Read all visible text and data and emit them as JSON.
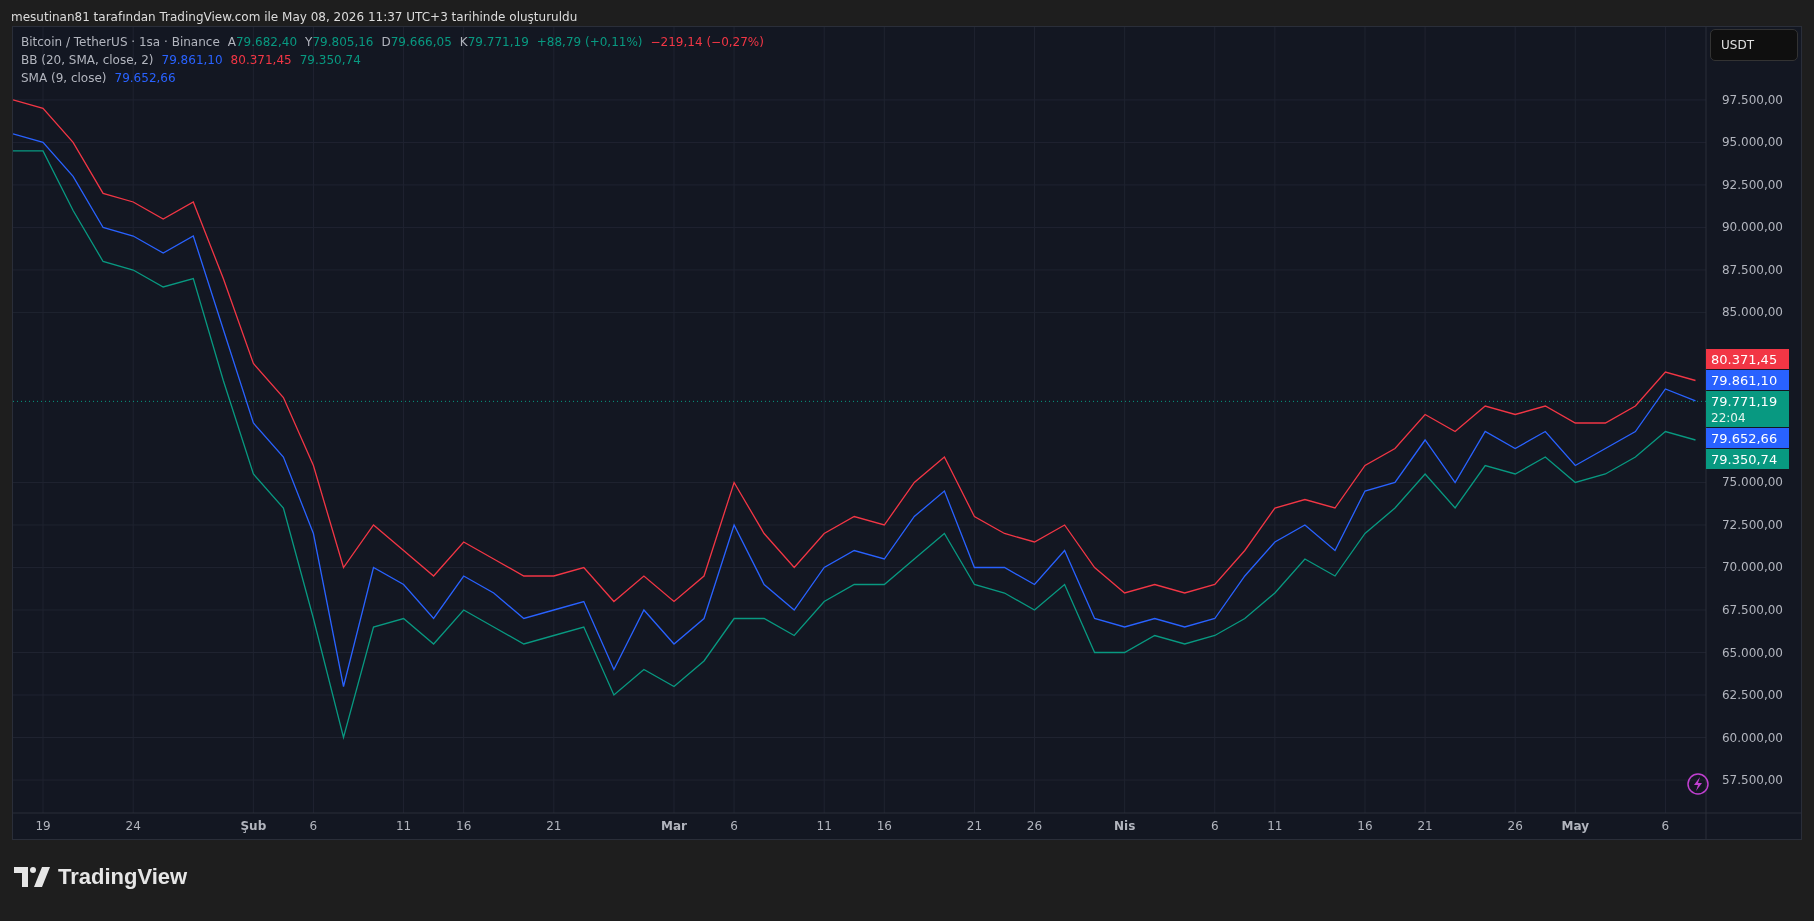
{
  "caption": "mesutinan81 tarafından TradingView.com ile May 08, 2026 11:37 UTC+3 tarihinde oluşturuldu",
  "legend": {
    "symbol": "Bitcoin / TetherUS · 1sa · Binance",
    "ohlc": [
      {
        "label": "A",
        "value": "79.682,40",
        "color": "#089981"
      },
      {
        "label": "Y",
        "value": "79.805,16",
        "color": "#089981"
      },
      {
        "label": "D",
        "value": "79.666,05",
        "color": "#089981"
      },
      {
        "label": "K",
        "value": "79.771,19",
        "color": "#089981"
      }
    ],
    "changes": [
      {
        "text": "+88,79 (+0,11%)",
        "color": "#089981"
      },
      {
        "text": "−219,14 (−0,27%)",
        "color": "#f23645"
      }
    ],
    "indicators": [
      {
        "name": "BB (20, SMA, close, 2)",
        "values": [
          {
            "text": "79.861,10",
            "color": "#2962ff"
          },
          {
            "text": "80.371,45",
            "color": "#f23645"
          },
          {
            "text": "79.350,74",
            "color": "#089981"
          }
        ]
      },
      {
        "name": "SMA (9, close)",
        "values": [
          {
            "text": "79.652,66",
            "color": "#2962ff"
          }
        ]
      }
    ]
  },
  "currency_button": "USDT",
  "price_tags": [
    {
      "value": "80.371,45",
      "color": "#f23645"
    },
    {
      "value": "79.861,10",
      "color": "#2962ff"
    },
    {
      "value": "79.771,19",
      "countdown": "22:04",
      "color": "#089981"
    },
    {
      "value": "79.652,66",
      "color": "#2962ff"
    },
    {
      "value": "79.350,74",
      "color": "#089981"
    }
  ],
  "chart_data": {
    "type": "line",
    "categories": [
      null,
      "19",
      null,
      null,
      "24",
      null,
      null,
      null,
      "Şub",
      null,
      "6",
      null,
      null,
      "11",
      null,
      "16",
      null,
      null,
      "21",
      null,
      null,
      null,
      "Mar",
      null,
      "6",
      null,
      null,
      "11",
      null,
      "16",
      null,
      null,
      "21",
      null,
      "26",
      null,
      null,
      "Nis",
      null,
      null,
      "6",
      null,
      "11",
      null,
      null,
      "16",
      null,
      "21",
      null,
      null,
      "26",
      null,
      "May",
      null,
      null,
      "6",
      null
    ],
    "series": [
      {
        "color": "#f23645",
        "values": [
          97500,
          97000,
          95000,
          92000,
          91500,
          90500,
          91500,
          87000,
          82000,
          80000,
          76000,
          70000,
          72500,
          71000,
          69500,
          71500,
          70500,
          69500,
          69500,
          70000,
          68000,
          69500,
          68000,
          69500,
          75000,
          72000,
          70000,
          72000,
          73000,
          72500,
          75000,
          76500,
          73000,
          72000,
          71500,
          72500,
          70000,
          68500,
          69000,
          68500,
          69000,
          71000,
          73500,
          74000,
          73500,
          76000,
          77000,
          79000,
          78000,
          79500,
          79000,
          79500,
          78500,
          78500,
          79500,
          81500,
          81000
        ]
      },
      {
        "color": "#2962ff",
        "values": [
          95500,
          95000,
          93000,
          90000,
          89500,
          88500,
          89500,
          84000,
          78500,
          76500,
          72000,
          63000,
          70000,
          69000,
          67000,
          69500,
          68500,
          67000,
          67500,
          68000,
          64000,
          67500,
          65500,
          67000,
          72500,
          69000,
          67500,
          70000,
          71000,
          70500,
          73000,
          74500,
          70000,
          70000,
          69000,
          71000,
          67000,
          66500,
          67000,
          66500,
          67000,
          69500,
          71500,
          72500,
          71000,
          74500,
          75000,
          77500,
          75000,
          78000,
          77000,
          78000,
          76000,
          77000,
          78000,
          80500,
          79800
        ]
      },
      {
        "color": "#089981",
        "values": [
          94500,
          94500,
          91000,
          88000,
          87500,
          86500,
          87000,
          81000,
          75500,
          73500,
          67000,
          60000,
          66500,
          67000,
          65500,
          67500,
          66500,
          65500,
          66000,
          66500,
          62500,
          64000,
          63000,
          64500,
          67000,
          67000,
          66000,
          68000,
          69000,
          69000,
          70500,
          72000,
          69000,
          68500,
          67500,
          69000,
          65000,
          65000,
          66000,
          65500,
          66000,
          67000,
          68500,
          70500,
          69500,
          72000,
          73500,
          75500,
          73500,
          76000,
          75500,
          76500,
          75000,
          75500,
          76500,
          78000,
          77500
        ]
      }
    ],
    "ylim": [
      55560,
      101790
    ],
    "yticks": [
      {
        "value": 97500,
        "label": "97.500,00"
      },
      {
        "value": 95000,
        "label": "95.000,00"
      },
      {
        "value": 92500,
        "label": "92.500,00"
      },
      {
        "value": 90000,
        "label": "90.000,00"
      },
      {
        "value": 87500,
        "label": "87.500,00"
      },
      {
        "value": 85000,
        "label": "85.000,00"
      },
      {
        "value": 75000,
        "label": "75.000,00"
      },
      {
        "value": 72500,
        "label": "72.500,00"
      },
      {
        "value": 70000,
        "label": "70.000,00"
      },
      {
        "value": 67500,
        "label": "67.500,00"
      },
      {
        "value": 65000,
        "label": "65.000,00"
      },
      {
        "value": 62500,
        "label": "62.500,00"
      },
      {
        "value": 60000,
        "label": "60.000,00"
      },
      {
        "value": 57500,
        "label": "57.500,00"
      }
    ],
    "grid": true,
    "ref_lines": [
      {
        "axis": "y",
        "value": 79771.19,
        "color": "#089981"
      }
    ]
  },
  "logo": "TradingView"
}
